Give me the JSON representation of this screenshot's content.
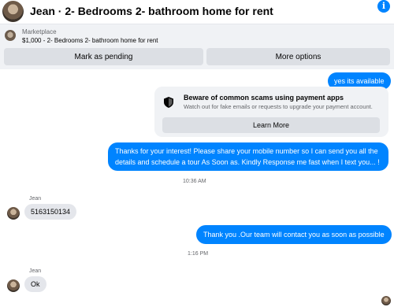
{
  "header": {
    "title": "Jean · 2- Bedrooms 2- bathroom home for rent",
    "info_icon": "info-icon"
  },
  "marketplace": {
    "label": "Marketplace",
    "listing": "$1,000 - 2- Bedrooms 2- bathroom home for rent",
    "pending_button": "Mark as pending",
    "more_button": "More options"
  },
  "scam_notice": {
    "heading": "Beware of common scams using payment apps",
    "description": "Watch out for fake emails or requests to upgrade your payment account.",
    "button": "Learn More",
    "icon": "shield-icon"
  },
  "messages": {
    "out_1": "yes its available",
    "out_2": "Thanks for your interest! Please share your mobile number so I can send you all the details and schedule a tour As Soon as. Kindly Response me fast when I text you... !",
    "time_1": "10:36 AM",
    "sender_1": "Jean",
    "in_1": "5163150134",
    "out_3": "Thank you .Our team will contact you as soon as possible",
    "time_2": "1:16 PM",
    "sender_2": "Jean",
    "in_2": "Ok"
  },
  "colors": {
    "accent": "#0084ff",
    "incoming_bubble": "#e4e6eb",
    "panel": "#f0f2f5"
  }
}
